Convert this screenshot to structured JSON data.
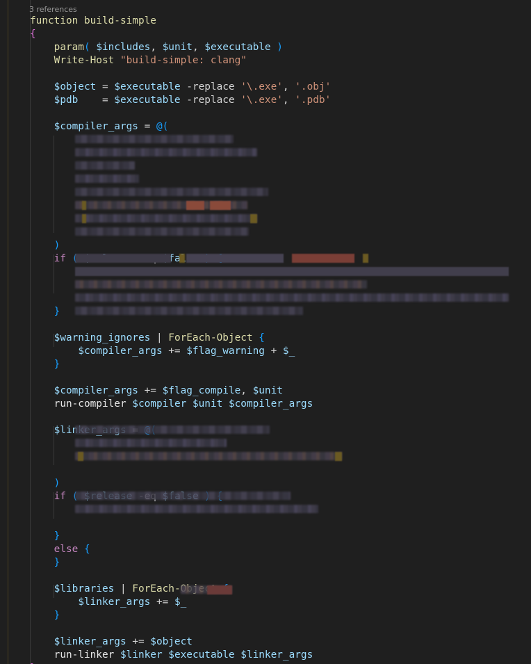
{
  "codelens": "3 references",
  "colors": {
    "background": "#1f1f1f",
    "keyword": "#c586c0",
    "function": "#dcdcaa",
    "variable": "#9cdcfe",
    "string": "#ce9178",
    "brace_gold": "#ffd700",
    "brace_pink": "#da70d6",
    "brace_blue": "#179fff"
  },
  "lines": [
    {
      "t": [
        {
          "c": "tk-fn",
          "v": "function"
        },
        {
          "c": "tk-plain",
          "v": " "
        },
        {
          "c": "tk-fn",
          "v": "build-simple"
        }
      ]
    },
    {
      "t": [
        {
          "c": "tk-brace-pink",
          "v": "{"
        }
      ]
    },
    {
      "t": [
        {
          "c": "tk-plain",
          "v": "    "
        },
        {
          "c": "tk-fn",
          "v": "param"
        },
        {
          "c": "tk-brace-blue",
          "v": "("
        },
        {
          "c": "tk-plain",
          "v": " "
        },
        {
          "c": "tk-var",
          "v": "$includes"
        },
        {
          "c": "tk-op",
          "v": ", "
        },
        {
          "c": "tk-var",
          "v": "$unit"
        },
        {
          "c": "tk-op",
          "v": ", "
        },
        {
          "c": "tk-var",
          "v": "$executable"
        },
        {
          "c": "tk-plain",
          "v": " "
        },
        {
          "c": "tk-brace-blue",
          "v": ")"
        }
      ]
    },
    {
      "t": [
        {
          "c": "tk-plain",
          "v": "    "
        },
        {
          "c": "tk-cmd",
          "v": "Write-Host"
        },
        {
          "c": "tk-plain",
          "v": " "
        },
        {
          "c": "tk-str",
          "v": "\"build-simple: clang\""
        }
      ]
    },
    {
      "t": []
    },
    {
      "t": [
        {
          "c": "tk-plain",
          "v": "    "
        },
        {
          "c": "tk-var",
          "v": "$object"
        },
        {
          "c": "tk-op",
          "v": " = "
        },
        {
          "c": "tk-var",
          "v": "$executable"
        },
        {
          "c": "tk-op",
          "v": " -replace "
        },
        {
          "c": "tk-str",
          "v": "'\\.exe'"
        },
        {
          "c": "tk-op",
          "v": ", "
        },
        {
          "c": "tk-str",
          "v": "'.obj'"
        }
      ]
    },
    {
      "t": [
        {
          "c": "tk-plain",
          "v": "    "
        },
        {
          "c": "tk-var",
          "v": "$pdb"
        },
        {
          "c": "tk-op",
          "v": "    = "
        },
        {
          "c": "tk-var",
          "v": "$executable"
        },
        {
          "c": "tk-op",
          "v": " -replace "
        },
        {
          "c": "tk-str",
          "v": "'\\.exe'"
        },
        {
          "c": "tk-op",
          "v": ", "
        },
        {
          "c": "tk-str",
          "v": "'.pdb'"
        }
      ]
    },
    {
      "t": []
    },
    {
      "t": [
        {
          "c": "tk-plain",
          "v": "    "
        },
        {
          "c": "tk-var",
          "v": "$compiler_args"
        },
        {
          "c": "tk-op",
          "v": " = "
        },
        {
          "c": "tk-brace-blue",
          "v": "@("
        }
      ]
    },
    {
      "t": []
    },
    {
      "t": []
    },
    {
      "t": []
    },
    {
      "t": []
    },
    {
      "t": []
    },
    {
      "t": []
    },
    {
      "t": []
    },
    {
      "t": []
    },
    {
      "t": [
        {
          "c": "tk-plain",
          "v": "    "
        },
        {
          "c": "tk-brace-blue",
          "v": ")"
        }
      ]
    },
    {
      "t": [
        {
          "c": "tk-plain",
          "v": "    "
        },
        {
          "c": "tk-kw",
          "v": "if"
        },
        {
          "c": "tk-plain",
          "v": " "
        },
        {
          "c": "tk-brace-blue",
          "v": "("
        },
        {
          "c": "tk-plain",
          "v": " "
        },
        {
          "c": "tk-var",
          "v": "$release"
        },
        {
          "c": "tk-op",
          "v": " -eq "
        },
        {
          "c": "tk-var",
          "v": "$false"
        },
        {
          "c": "tk-plain",
          "v": " "
        },
        {
          "c": "tk-brace-blue",
          "v": ")"
        },
        {
          "c": "tk-plain",
          "v": " "
        },
        {
          "c": "tk-brace-blue",
          "v": "{"
        }
      ]
    },
    {
      "t": []
    },
    {
      "t": []
    },
    {
      "t": []
    },
    {
      "t": [
        {
          "c": "tk-plain",
          "v": "    "
        },
        {
          "c": "tk-brace-blue",
          "v": "}"
        }
      ]
    },
    {
      "t": []
    },
    {
      "t": [
        {
          "c": "tk-plain",
          "v": "    "
        },
        {
          "c": "tk-var",
          "v": "$warning_ignores"
        },
        {
          "c": "tk-op",
          "v": " | "
        },
        {
          "c": "tk-cmd",
          "v": "ForEach-Object"
        },
        {
          "c": "tk-plain",
          "v": " "
        },
        {
          "c": "tk-brace-blue",
          "v": "{"
        }
      ]
    },
    {
      "t": [
        {
          "c": "tk-plain",
          "v": "        "
        },
        {
          "c": "tk-var",
          "v": "$compiler_args"
        },
        {
          "c": "tk-op",
          "v": " += "
        },
        {
          "c": "tk-var",
          "v": "$flag_warning"
        },
        {
          "c": "tk-op",
          "v": " + "
        },
        {
          "c": "tk-var",
          "v": "$_"
        }
      ]
    },
    {
      "t": [
        {
          "c": "tk-plain",
          "v": "    "
        },
        {
          "c": "tk-brace-blue",
          "v": "}"
        }
      ]
    },
    {
      "t": []
    },
    {
      "t": [
        {
          "c": "tk-plain",
          "v": "    "
        },
        {
          "c": "tk-var",
          "v": "$compiler_args"
        },
        {
          "c": "tk-op",
          "v": " += "
        },
        {
          "c": "tk-var",
          "v": "$flag_compile"
        },
        {
          "c": "tk-op",
          "v": ", "
        },
        {
          "c": "tk-var",
          "v": "$unit"
        }
      ]
    },
    {
      "t": [
        {
          "c": "tk-plain",
          "v": "    "
        },
        {
          "c": "tk-white",
          "v": "run-compiler"
        },
        {
          "c": "tk-plain",
          "v": " "
        },
        {
          "c": "tk-var",
          "v": "$compiler"
        },
        {
          "c": "tk-plain",
          "v": " "
        },
        {
          "c": "tk-var",
          "v": "$unit"
        },
        {
          "c": "tk-plain",
          "v": " "
        },
        {
          "c": "tk-var",
          "v": "$compiler_args"
        }
      ]
    },
    {
      "t": []
    },
    {
      "t": [
        {
          "c": "tk-plain",
          "v": "    "
        },
        {
          "c": "tk-var",
          "v": "$linker_args"
        },
        {
          "c": "tk-op",
          "v": " = "
        },
        {
          "c": "tk-brace-blue",
          "v": "@("
        }
      ]
    },
    {
      "t": []
    },
    {
      "t": []
    },
    {
      "t": []
    },
    {
      "t": [
        {
          "c": "tk-plain",
          "v": "    "
        },
        {
          "c": "tk-brace-blue",
          "v": ")"
        }
      ]
    },
    {
      "t": [
        {
          "c": "tk-plain",
          "v": "    "
        },
        {
          "c": "tk-kw",
          "v": "if"
        },
        {
          "c": "tk-plain",
          "v": " "
        },
        {
          "c": "tk-brace-blue",
          "v": "("
        },
        {
          "c": "tk-plain",
          "v": " "
        },
        {
          "c": "tk-var",
          "v": "$release"
        },
        {
          "c": "tk-op",
          "v": " -eq "
        },
        {
          "c": "tk-var",
          "v": "$false"
        },
        {
          "c": "tk-plain",
          "v": " "
        },
        {
          "c": "tk-brace-blue",
          "v": ")"
        },
        {
          "c": "tk-plain",
          "v": " "
        },
        {
          "c": "tk-brace-blue",
          "v": "{"
        }
      ]
    },
    {
      "t": []
    },
    {
      "t": []
    },
    {
      "t": [
        {
          "c": "tk-plain",
          "v": "    "
        },
        {
          "c": "tk-brace-blue",
          "v": "}"
        }
      ]
    },
    {
      "t": [
        {
          "c": "tk-plain",
          "v": "    "
        },
        {
          "c": "tk-kw",
          "v": "else"
        },
        {
          "c": "tk-plain",
          "v": " "
        },
        {
          "c": "tk-brace-blue",
          "v": "{"
        }
      ]
    },
    {
      "t": [
        {
          "c": "tk-plain",
          "v": "    "
        },
        {
          "c": "tk-brace-blue",
          "v": "}"
        }
      ]
    },
    {
      "t": []
    },
    {
      "t": [
        {
          "c": "tk-plain",
          "v": "    "
        },
        {
          "c": "tk-var",
          "v": "$libraries"
        },
        {
          "c": "tk-op",
          "v": " | "
        },
        {
          "c": "tk-cmd",
          "v": "ForEach-Object"
        },
        {
          "c": "tk-plain",
          "v": " "
        },
        {
          "c": "tk-brace-blue",
          "v": "{"
        }
      ]
    },
    {
      "t": [
        {
          "c": "tk-plain",
          "v": "        "
        },
        {
          "c": "tk-var",
          "v": "$linker_args"
        },
        {
          "c": "tk-op",
          "v": " += "
        },
        {
          "c": "tk-var",
          "v": "$_"
        }
      ]
    },
    {
      "t": [
        {
          "c": "tk-plain",
          "v": "    "
        },
        {
          "c": "tk-brace-blue",
          "v": "}"
        }
      ]
    },
    {
      "t": []
    },
    {
      "t": [
        {
          "c": "tk-plain",
          "v": "    "
        },
        {
          "c": "tk-var",
          "v": "$linker_args"
        },
        {
          "c": "tk-op",
          "v": " += "
        },
        {
          "c": "tk-var",
          "v": "$object"
        }
      ]
    },
    {
      "t": [
        {
          "c": "tk-plain",
          "v": "    "
        },
        {
          "c": "tk-white",
          "v": "run-linker"
        },
        {
          "c": "tk-plain",
          "v": " "
        },
        {
          "c": "tk-var",
          "v": "$linker"
        },
        {
          "c": "tk-plain",
          "v": " "
        },
        {
          "c": "tk-var",
          "v": "$executable"
        },
        {
          "c": "tk-plain",
          "v": " "
        },
        {
          "c": "tk-var",
          "v": "$linker_args"
        }
      ]
    },
    {
      "t": [
        {
          "c": "tk-brace-pink",
          "v": "}"
        }
      ]
    }
  ]
}
